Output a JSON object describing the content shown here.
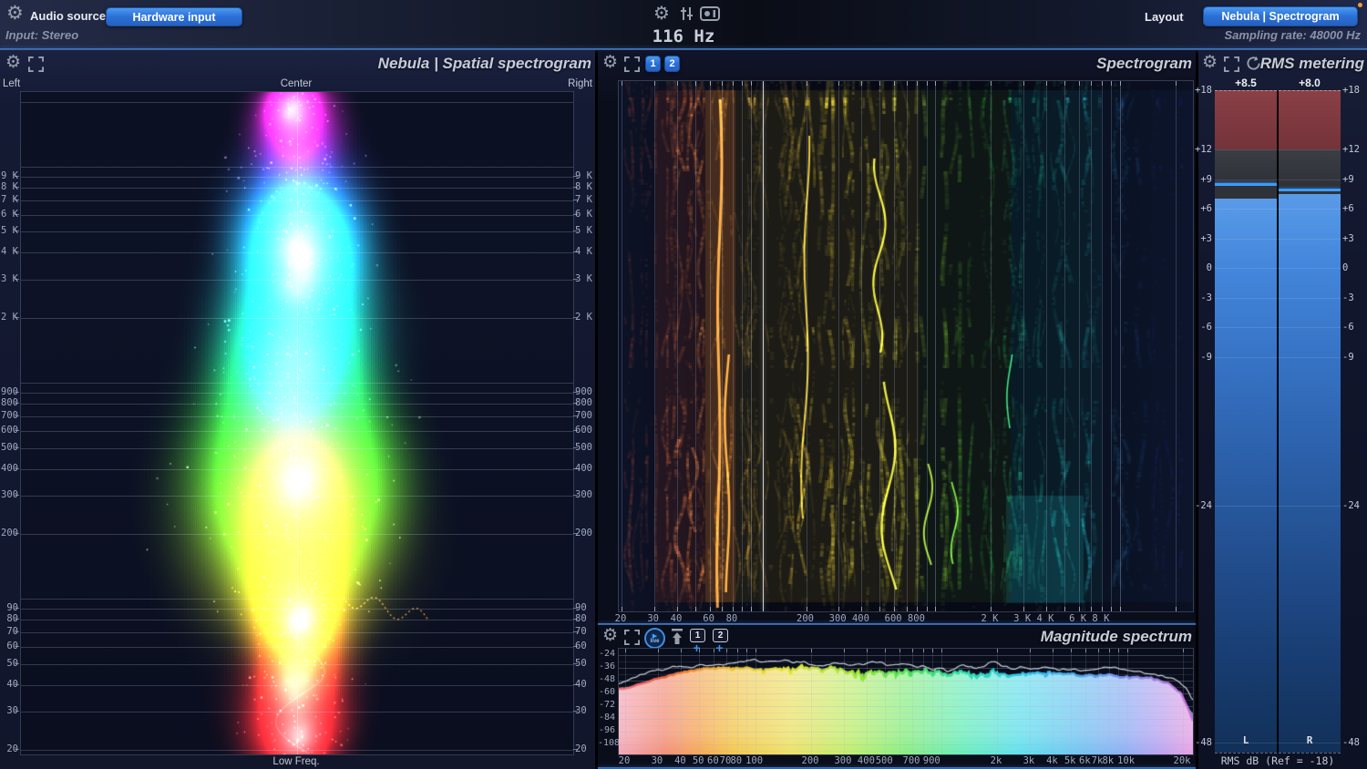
{
  "top_bar": {
    "audio_source_label": "Audio source",
    "hardware_input_button": "Hardware input",
    "input_status": "Input: Stereo",
    "frequency_readout": "116 Hz",
    "cursor_hz": 116,
    "layout_label": "Layout",
    "layout_preset_button": "Nebula | Spectrogram",
    "sampling_rate": "Sampling rate: 48000 Hz"
  },
  "spatial_spectrogram": {
    "title": "Nebula | Spatial spectrogram",
    "pan_left": "Left",
    "pan_center": "Center",
    "pan_right": "Right",
    "bottom_label": "Low Freq.",
    "freq_ticks": [
      [
        9000,
        "9 K"
      ],
      [
        8000,
        "8 K"
      ],
      [
        7000,
        "7 K"
      ],
      [
        6000,
        "6 K"
      ],
      [
        5000,
        "5 K"
      ],
      [
        4000,
        "4 K"
      ],
      [
        3000,
        "3 K"
      ],
      [
        2000,
        "2 K"
      ],
      [
        900,
        "900"
      ],
      [
        800,
        "800"
      ],
      [
        700,
        "700"
      ],
      [
        600,
        "600"
      ],
      [
        500,
        "500"
      ],
      [
        400,
        "400"
      ],
      [
        300,
        "300"
      ],
      [
        200,
        "200"
      ],
      [
        90,
        "90"
      ],
      [
        80,
        "80"
      ],
      [
        70,
        "70"
      ],
      [
        60,
        "60"
      ],
      [
        50,
        "50"
      ],
      [
        40,
        "40"
      ],
      [
        30,
        "30"
      ],
      [
        20,
        "20"
      ]
    ]
  },
  "spectrogram": {
    "title": "Spectrogram",
    "view_buttons": [
      "1",
      "2"
    ],
    "freq_ticks": [
      [
        20,
        "20"
      ],
      [
        30,
        "30"
      ],
      [
        40,
        "40"
      ],
      [
        60,
        "60"
      ],
      [
        80,
        "80"
      ],
      [
        200,
        "200"
      ],
      [
        300,
        "300"
      ],
      [
        400,
        "400"
      ],
      [
        600,
        "600"
      ],
      [
        800,
        "800"
      ],
      [
        2000,
        "2 K"
      ],
      [
        3000,
        "3 K"
      ],
      [
        4000,
        "4 K"
      ],
      [
        6000,
        "6 K"
      ],
      [
        8000,
        "8 K"
      ]
    ]
  },
  "magnitude_spectrum": {
    "title": "Magnitude spectrum",
    "live_button": "live",
    "snapshot_buttons": [
      "1",
      "2"
    ],
    "add_label": "+",
    "db_ticks": [
      [
        -24,
        "-24"
      ],
      [
        -36,
        "-36"
      ],
      [
        -48,
        "-48"
      ],
      [
        -60,
        "-60"
      ],
      [
        -72,
        "-72"
      ],
      [
        -84,
        "-84"
      ],
      [
        -96,
        "-96"
      ],
      [
        -108,
        "-108"
      ]
    ],
    "freq_ticks": [
      [
        20,
        "20"
      ],
      [
        30,
        "30"
      ],
      [
        40,
        "40"
      ],
      [
        50,
        "50"
      ],
      [
        60,
        "60"
      ],
      [
        70,
        "70"
      ],
      [
        80,
        "80"
      ],
      [
        100,
        "100"
      ],
      [
        200,
        "200"
      ],
      [
        300,
        "300"
      ],
      [
        400,
        "400"
      ],
      [
        500,
        "500"
      ],
      [
        700,
        "700"
      ],
      [
        900,
        "900"
      ],
      [
        2000,
        "2k"
      ],
      [
        3000,
        "3k"
      ],
      [
        4000,
        "4k"
      ],
      [
        5000,
        "5k"
      ],
      [
        6000,
        "6k"
      ],
      [
        7000,
        "7k"
      ],
      [
        8000,
        "8k"
      ],
      [
        10000,
        "10k"
      ],
      [
        20000,
        "20k"
      ]
    ]
  },
  "rms_metering": {
    "title": "RMS metering",
    "channels": [
      {
        "label": "L",
        "value_label": "+8.5",
        "rms_db": 8.5,
        "fill_top_db": 7.0
      },
      {
        "label": "R",
        "value_label": "+8.0",
        "rms_db": 8.0,
        "fill_top_db": 7.5
      }
    ],
    "scale_ticks": [
      [
        18,
        "+18"
      ],
      [
        12,
        "+12"
      ],
      [
        9,
        "+9"
      ],
      [
        6,
        "+6"
      ],
      [
        3,
        "+3"
      ],
      [
        0,
        "0"
      ],
      [
        -3,
        "-3"
      ],
      [
        -6,
        "-6"
      ],
      [
        -9,
        "-9"
      ],
      [
        -24,
        "-24"
      ],
      [
        -48,
        "-48"
      ]
    ],
    "footer": "RMS dB (Ref = -18)"
  },
  "colors": {
    "accent": "#3b86e8",
    "meter_red": "#7e3a3e",
    "meter_gray": "#35383e",
    "meter_blue": "#4a8de0",
    "rms_line": "#3b9cff",
    "cursor": "#ffffff",
    "title_text": "#c6ccd8",
    "axis_text": "#9fa9c0",
    "notification": "#e8a03a"
  }
}
